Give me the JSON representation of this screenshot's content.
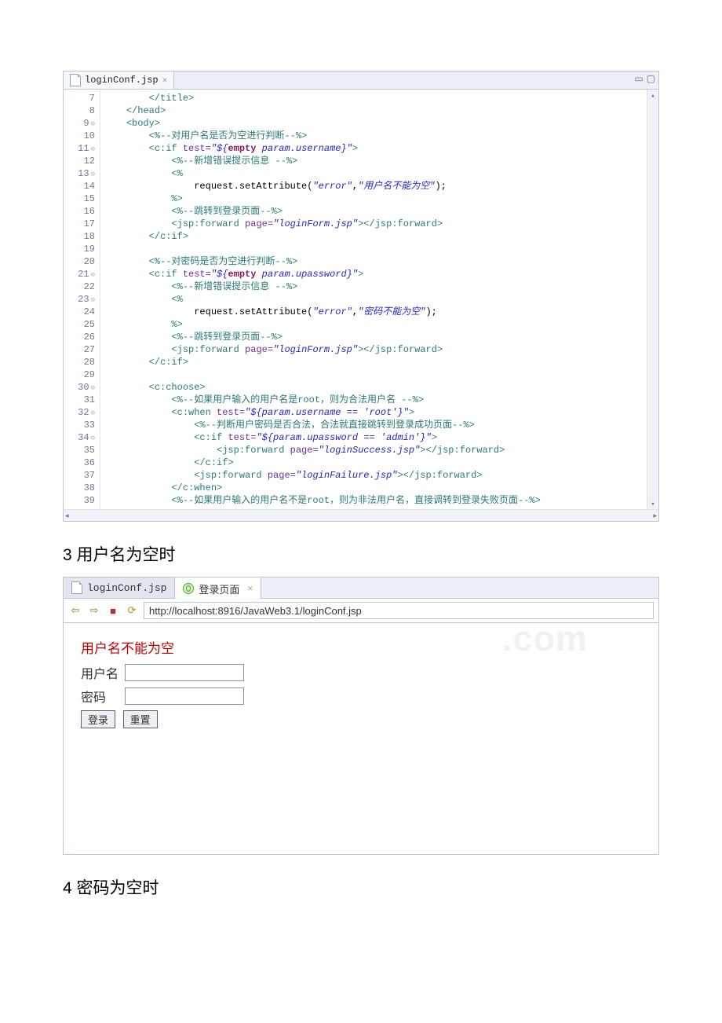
{
  "editor": {
    "tab_label": "loginConf.jsp",
    "tab_close_glyph": "✕",
    "ctrl_minimize": "▭",
    "ctrl_maximize": "▢",
    "gutter_start": 7,
    "lines": [
      {
        "n": 7,
        "fold": "",
        "ind": 2,
        "parts": [
          {
            "c": "tag",
            "t": "</title>"
          }
        ]
      },
      {
        "n": 8,
        "fold": "",
        "ind": 1,
        "parts": [
          {
            "c": "tag",
            "t": "</head>"
          }
        ]
      },
      {
        "n": 9,
        "fold": "⊖",
        "ind": 1,
        "parts": [
          {
            "c": "tag",
            "t": "<body>"
          }
        ]
      },
      {
        "n": 10,
        "fold": "",
        "ind": 2,
        "parts": [
          {
            "c": "cmt",
            "t": "<%--对用户名是否为空进行判断--%>"
          }
        ]
      },
      {
        "n": 11,
        "fold": "⊖",
        "ind": 2,
        "parts": [
          {
            "c": "tag",
            "t": "<c:if "
          },
          {
            "c": "attr",
            "t": "test="
          },
          {
            "c": "str",
            "t": "\"${"
          },
          {
            "c": "kw",
            "t": "empty"
          },
          {
            "c": "str",
            "t": " param.username}\""
          },
          {
            "c": "tag",
            "t": ">"
          }
        ]
      },
      {
        "n": 12,
        "fold": "",
        "ind": 3,
        "parts": [
          {
            "c": "cmt",
            "t": "<%--新增错误提示信息 --%>"
          }
        ]
      },
      {
        "n": 13,
        "fold": "⊖",
        "ind": 3,
        "parts": [
          {
            "c": "tag",
            "t": "<%"
          }
        ]
      },
      {
        "n": 14,
        "fold": "",
        "ind": 4,
        "parts": [
          {
            "c": "txt",
            "t": "request.setAttribute("
          },
          {
            "c": "str",
            "t": "\"error\""
          },
          {
            "c": "txt",
            "t": ","
          },
          {
            "c": "str",
            "t": "\"用户名不能为空\""
          },
          {
            "c": "txt",
            "t": ");"
          }
        ]
      },
      {
        "n": 15,
        "fold": "",
        "ind": 3,
        "parts": [
          {
            "c": "tag",
            "t": "%>"
          }
        ]
      },
      {
        "n": 16,
        "fold": "",
        "ind": 3,
        "parts": [
          {
            "c": "cmt",
            "t": "<%--跳转到登录页面--%>"
          }
        ]
      },
      {
        "n": 17,
        "fold": "",
        "ind": 3,
        "parts": [
          {
            "c": "tag",
            "t": "<jsp:forward "
          },
          {
            "c": "attr",
            "t": "page="
          },
          {
            "c": "str",
            "t": "\"loginForm.jsp\""
          },
          {
            "c": "tag",
            "t": "></jsp:forward>"
          }
        ]
      },
      {
        "n": 18,
        "fold": "",
        "ind": 2,
        "parts": [
          {
            "c": "tag",
            "t": "</c:if>"
          }
        ]
      },
      {
        "n": 19,
        "fold": "",
        "ind": 0,
        "parts": [
          {
            "c": "txt",
            "t": ""
          }
        ]
      },
      {
        "n": 20,
        "fold": "",
        "ind": 2,
        "parts": [
          {
            "c": "cmt",
            "t": "<%--对密码是否为空进行判断--%>"
          }
        ]
      },
      {
        "n": 21,
        "fold": "⊖",
        "ind": 2,
        "parts": [
          {
            "c": "tag",
            "t": "<c:if "
          },
          {
            "c": "attr",
            "t": "test="
          },
          {
            "c": "str",
            "t": "\"${"
          },
          {
            "c": "kw",
            "t": "empty"
          },
          {
            "c": "str",
            "t": " param.upassword}\""
          },
          {
            "c": "tag",
            "t": ">"
          }
        ]
      },
      {
        "n": 22,
        "fold": "",
        "ind": 3,
        "parts": [
          {
            "c": "cmt",
            "t": "<%--新增错误提示信息 --%>"
          }
        ]
      },
      {
        "n": 23,
        "fold": "⊖",
        "ind": 3,
        "parts": [
          {
            "c": "tag",
            "t": "<%"
          }
        ]
      },
      {
        "n": 24,
        "fold": "",
        "ind": 4,
        "parts": [
          {
            "c": "txt",
            "t": "request.setAttribute("
          },
          {
            "c": "str",
            "t": "\"error\""
          },
          {
            "c": "txt",
            "t": ","
          },
          {
            "c": "str",
            "t": "\"密码不能为空\""
          },
          {
            "c": "txt",
            "t": ");"
          }
        ]
      },
      {
        "n": 25,
        "fold": "",
        "ind": 3,
        "parts": [
          {
            "c": "tag",
            "t": "%>"
          }
        ]
      },
      {
        "n": 26,
        "fold": "",
        "ind": 3,
        "parts": [
          {
            "c": "cmt",
            "t": "<%--跳转到登录页面--%>"
          }
        ]
      },
      {
        "n": 27,
        "fold": "",
        "ind": 3,
        "parts": [
          {
            "c": "tag",
            "t": "<jsp:forward "
          },
          {
            "c": "attr",
            "t": "page="
          },
          {
            "c": "str",
            "t": "\"loginForm.jsp\""
          },
          {
            "c": "tag",
            "t": "></jsp:forward>"
          }
        ]
      },
      {
        "n": 28,
        "fold": "",
        "ind": 2,
        "parts": [
          {
            "c": "tag",
            "t": "</c:if>"
          }
        ]
      },
      {
        "n": 29,
        "fold": "",
        "ind": 0,
        "parts": [
          {
            "c": "txt",
            "t": ""
          }
        ]
      },
      {
        "n": 30,
        "fold": "⊖",
        "ind": 2,
        "parts": [
          {
            "c": "tag",
            "t": "<c:choose>"
          }
        ]
      },
      {
        "n": 31,
        "fold": "",
        "ind": 3,
        "parts": [
          {
            "c": "cmt",
            "t": "<%--如果用户输入的用户名是root，则为合法用户名 --%>"
          }
        ]
      },
      {
        "n": 32,
        "fold": "⊖",
        "ind": 3,
        "parts": [
          {
            "c": "tag",
            "t": "<c:when "
          },
          {
            "c": "attr",
            "t": "test="
          },
          {
            "c": "str",
            "t": "\"${param.username == 'root'}\""
          },
          {
            "c": "tag",
            "t": ">"
          }
        ]
      },
      {
        "n": 33,
        "fold": "",
        "ind": 4,
        "parts": [
          {
            "c": "cmt",
            "t": "<%--判断用户密码是否合法，合法就直接跳转到登录成功页面--%>"
          }
        ]
      },
      {
        "n": 34,
        "fold": "⊖",
        "ind": 4,
        "parts": [
          {
            "c": "tag",
            "t": "<c:if "
          },
          {
            "c": "attr",
            "t": "test="
          },
          {
            "c": "str",
            "t": "\"${param.upassword == 'admin'}\""
          },
          {
            "c": "tag",
            "t": ">"
          }
        ]
      },
      {
        "n": 35,
        "fold": "",
        "ind": 5,
        "parts": [
          {
            "c": "tag",
            "t": "<jsp:forward "
          },
          {
            "c": "attr",
            "t": "page="
          },
          {
            "c": "str",
            "t": "\"loginSuccess.jsp\""
          },
          {
            "c": "tag",
            "t": "></jsp:forward>"
          }
        ]
      },
      {
        "n": 36,
        "fold": "",
        "ind": 4,
        "parts": [
          {
            "c": "tag",
            "t": "</c:if>"
          }
        ]
      },
      {
        "n": 37,
        "fold": "",
        "ind": 4,
        "parts": [
          {
            "c": "tag",
            "t": "<jsp:forward "
          },
          {
            "c": "attr",
            "t": "page="
          },
          {
            "c": "str",
            "t": "\"loginFailure.jsp\""
          },
          {
            "c": "tag",
            "t": "></jsp:forward>"
          }
        ]
      },
      {
        "n": 38,
        "fold": "",
        "ind": 3,
        "parts": [
          {
            "c": "tag",
            "t": "</c:when>"
          }
        ]
      },
      {
        "n": 39,
        "fold": "",
        "ind": 3,
        "parts": [
          {
            "c": "cmt",
            "t": "<%--如果用户输入的用户名不是root，则为非法用户名，直接调转到登录失败页面--%>"
          }
        ]
      }
    ]
  },
  "heading1": "3 用户名为空时",
  "browser": {
    "tab1_label": "loginConf.jsp",
    "tab2_label": "登录页面",
    "tab_close_glyph": "✕",
    "url": "http://localhost:8916/JavaWeb3.1/loginConf.jsp",
    "watermark": ".com",
    "error_message": "用户名不能为空",
    "field_user_label": "用户名",
    "field_pass_label": "密码",
    "btn_submit": "登录",
    "btn_reset": "重置"
  },
  "heading2": "4 密码为空时"
}
